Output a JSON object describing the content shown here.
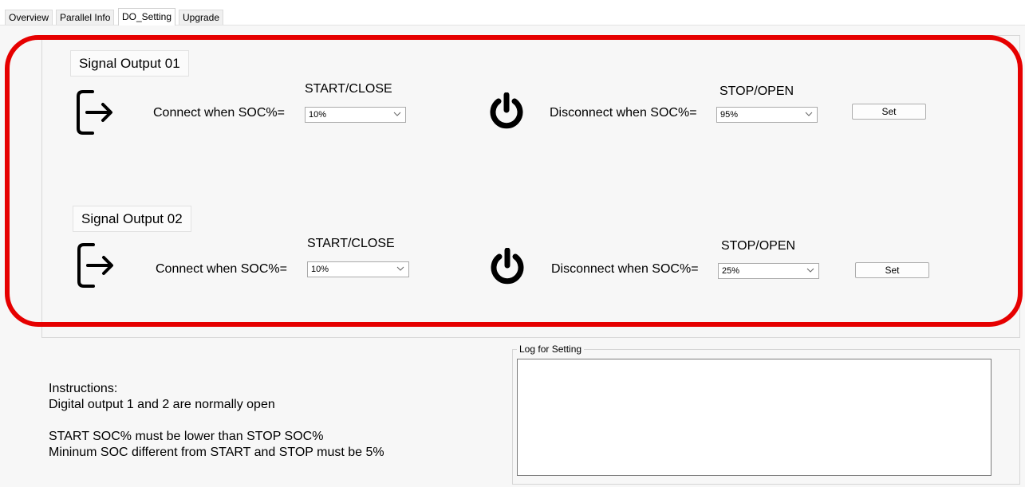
{
  "tabs": [
    {
      "label": "Overview"
    },
    {
      "label": "Parallel Info"
    },
    {
      "label": "DO_Setting"
    },
    {
      "label": "Upgrade"
    }
  ],
  "active_tab": "DO_Setting",
  "outputs": [
    {
      "title": "Signal Output 01",
      "start_heading": "START/CLOSE",
      "connect_label": "Connect when SOC%=",
      "connect_value": "10%",
      "stop_heading": "STOP/OPEN",
      "disconnect_label": "Disconnect when SOC%=",
      "disconnect_value": "95%",
      "set_label": "Set"
    },
    {
      "title": "Signal Output 02",
      "start_heading": "START/CLOSE",
      "connect_label": "Connect when SOC%=",
      "connect_value": "10%",
      "stop_heading": "STOP/OPEN",
      "disconnect_label": "Disconnect when SOC%=",
      "disconnect_value": "25%",
      "set_label": "Set"
    }
  ],
  "instructions": {
    "text": "Instructions:\nDigital output 1 and 2 are normally open\n\nSTART SOC% must be lower than STOP SOC%\nMininum SOC different from START and STOP must be 5%"
  },
  "log": {
    "legend": "Log for Setting",
    "content": ""
  },
  "colors": {
    "highlight": "#e60000",
    "background": "#f7f7f7"
  },
  "icons": {
    "start": "exit-arrow-icon",
    "stop": "power-icon",
    "dropdown": "chevron-down-icon"
  }
}
